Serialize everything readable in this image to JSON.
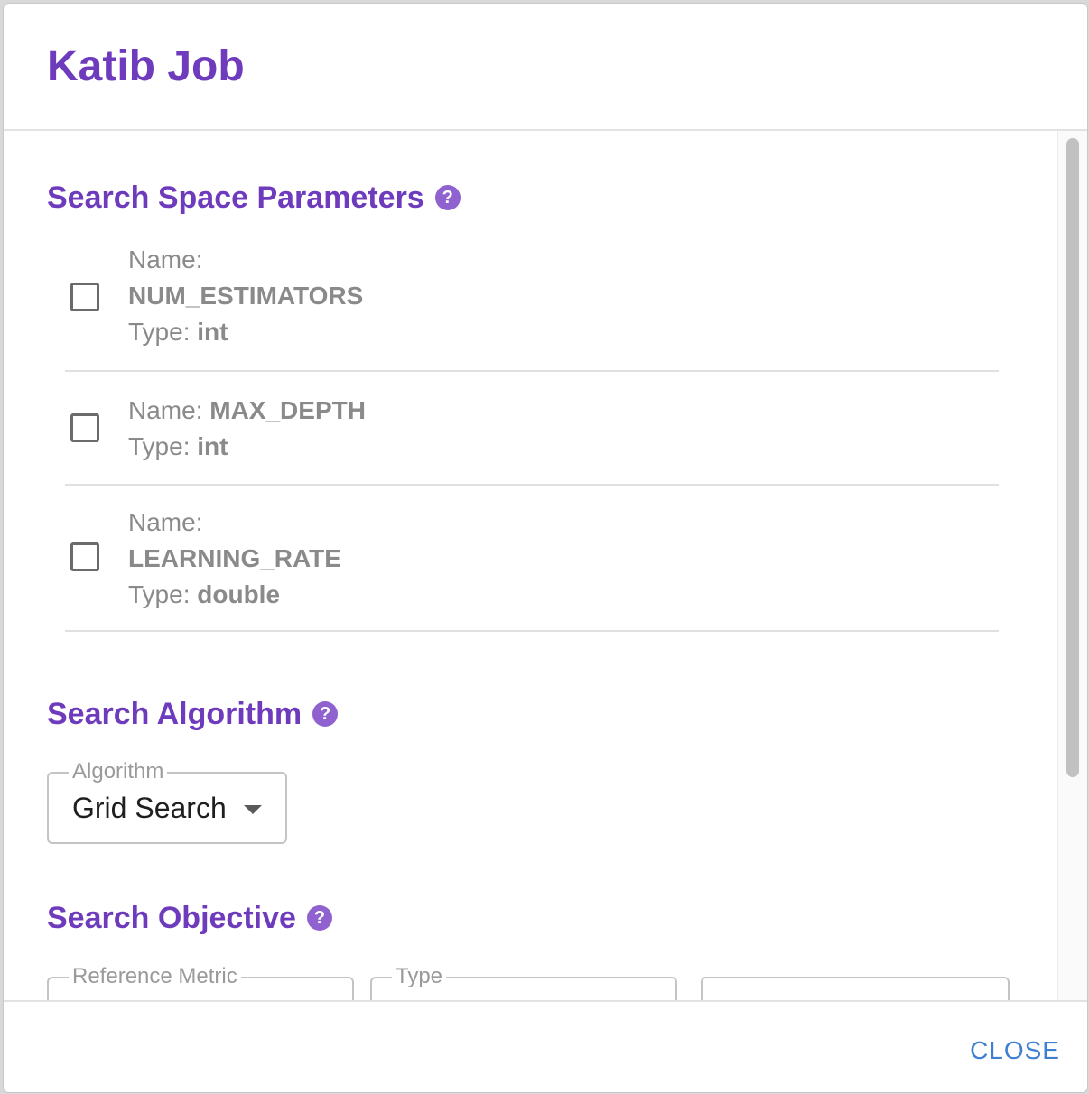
{
  "dialog": {
    "title": "Katib Job"
  },
  "sections": {
    "search_space": {
      "heading": "Search Space Parameters",
      "help_glyph": "?"
    },
    "search_algorithm": {
      "heading": "Search Algorithm",
      "help_glyph": "?",
      "field_label": "Algorithm",
      "selected_value": "Grid Search"
    },
    "search_objective": {
      "heading": "Search Objective",
      "help_glyph": "?",
      "reference_metric_label": "Reference Metric",
      "type_label": "Type"
    }
  },
  "parameters": [
    {
      "name_label": "Name:",
      "name": "NUM_ESTIMATORS",
      "type_label": "Type:",
      "type": "int",
      "checked": false
    },
    {
      "name_label": "Name:",
      "name": "MAX_DEPTH",
      "type_label": "Type:",
      "type": "int",
      "checked": false
    },
    {
      "name_label": "Name:",
      "name": "LEARNING_RATE",
      "type_label": "Type:",
      "type": "double",
      "checked": false
    }
  ],
  "actions": {
    "close_label": "CLOSE"
  },
  "colors": {
    "accent": "#6f3bbd",
    "help_icon": "#8f62cf",
    "link": "#3f7fd1",
    "muted_text": "#8a8a8a"
  },
  "icons": {
    "help": "help-circle-icon",
    "dropdown": "caret-down-icon",
    "checkbox": "checkbox-unchecked-icon"
  }
}
